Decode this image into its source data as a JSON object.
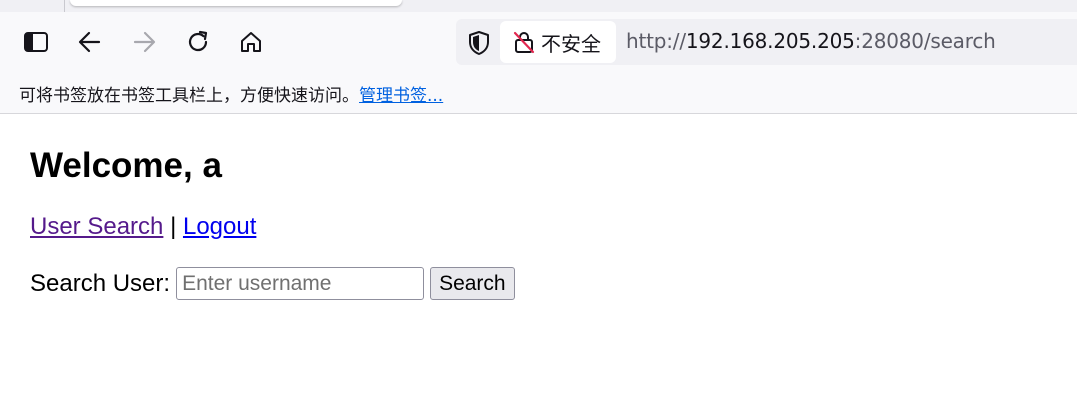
{
  "browser": {
    "security_label": "不安全",
    "url_scheme": "http://",
    "url_host": "192.168.205.205",
    "url_rest": ":28080/search",
    "bookmarks_hint": "可将书签放在书签工具栏上，方便快速访问。",
    "bookmarks_manage": "管理书签..."
  },
  "page": {
    "title": "Welcome, a",
    "nav": {
      "user_search": "User Search",
      "separator": "|",
      "logout": "Logout"
    },
    "search": {
      "label": "Search User:",
      "placeholder": "Enter username",
      "value": "",
      "button": "Search"
    }
  },
  "colors": {
    "visited_link": "#551a8b",
    "link": "#0000ee",
    "manage_link": "#0061e0"
  },
  "icons": [
    "sidebar-icon",
    "back-icon",
    "forward-icon",
    "reload-icon",
    "home-icon",
    "shield-icon",
    "insecure-lock-icon"
  ]
}
